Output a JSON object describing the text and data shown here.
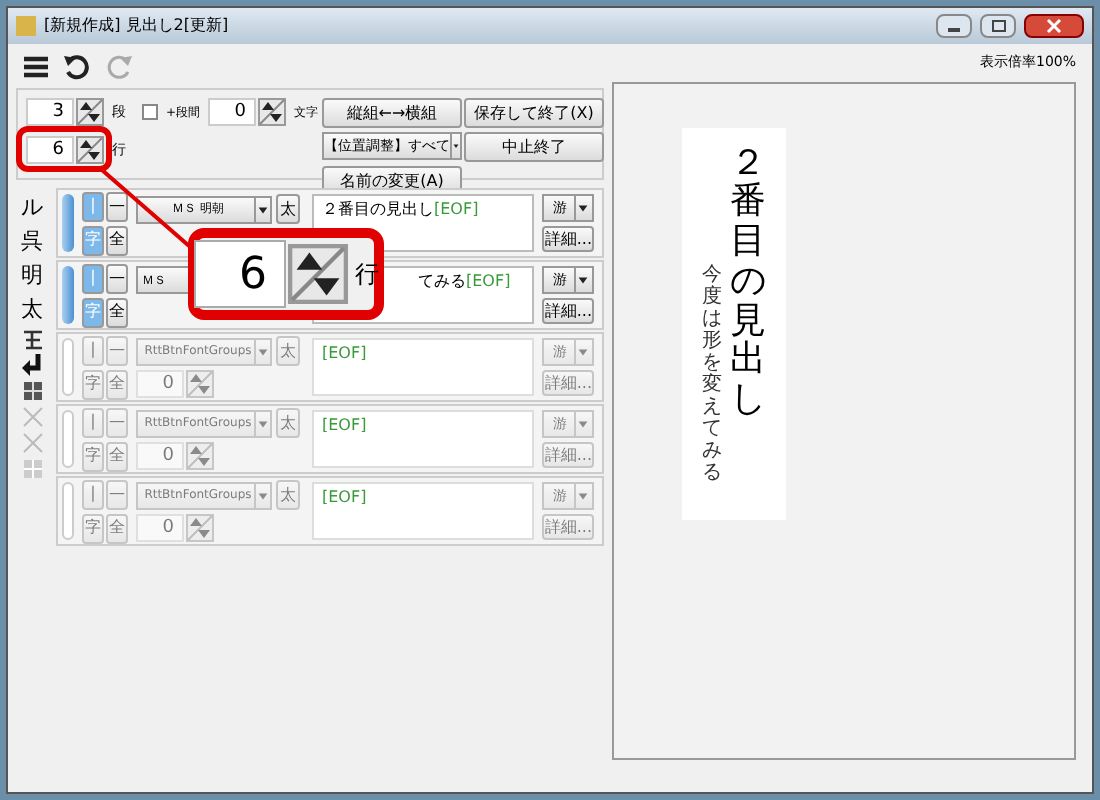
{
  "window": {
    "title": "[新規作成] 見出し2[更新]"
  },
  "settings": {
    "columns": {
      "value": "3",
      "unit": "段"
    },
    "gap_checkbox": {
      "label": "+段間",
      "checked": false
    },
    "gap": {
      "value": "0",
      "unit": "文字"
    },
    "lines": {
      "value": "6",
      "unit": "行"
    }
  },
  "buttons": [
    {
      "kind": "button",
      "label": "縦組←→横組"
    },
    {
      "kind": "button",
      "label": "保存して終了(X)"
    },
    {
      "kind": "dropdown",
      "label": "【位置調整】すべて"
    },
    {
      "kind": "button",
      "label": "中止終了"
    },
    {
      "kind": "button",
      "label": "名前の変更(A)"
    }
  ],
  "side_strip": [
    "ル",
    "呉",
    "明",
    "太"
  ],
  "entries": [
    {
      "enabled": true,
      "vertical_label": "|",
      "horizontal_label": "—",
      "char_label": "字",
      "full_label": "全",
      "font": "ＭＳ 明朝",
      "bold_label": "太",
      "text": "２番目の見出し",
      "eof": "[EOF]",
      "style": "游",
      "detail": "詳細..."
    },
    {
      "enabled": true,
      "vertical_label": "|",
      "horizontal_label": "—",
      "char_label": "字",
      "full_label": "全",
      "font": "ＭＳ",
      "text": "てみる",
      "eof": "[EOF]",
      "style": "游",
      "detail": "詳細..."
    },
    {
      "enabled": false,
      "vertical_label": "|",
      "horizontal_label": "—",
      "char_label": "字",
      "full_label": "全",
      "font": "RttBtnFontGroups",
      "bold_label": "太",
      "size": "0",
      "eof": "[EOF]",
      "style": "游",
      "detail": "詳細..."
    },
    {
      "enabled": false,
      "vertical_label": "|",
      "horizontal_label": "—",
      "char_label": "字",
      "full_label": "全",
      "font": "RttBtnFontGroups",
      "bold_label": "太",
      "size": "0",
      "eof": "[EOF]",
      "style": "游",
      "detail": "詳細..."
    },
    {
      "enabled": false,
      "vertical_label": "|",
      "horizontal_label": "—",
      "char_label": "字",
      "full_label": "全",
      "font": "RttBtnFontGroups",
      "bold_label": "太",
      "size": "0",
      "eof": "[EOF]",
      "style": "游",
      "detail": "詳細..."
    }
  ],
  "callout": {
    "value": "6",
    "unit": "行"
  },
  "preview": {
    "zoom": "表示倍率100%",
    "title": "２番目の見出し",
    "subtitle": "今度は形を変えてみる"
  }
}
